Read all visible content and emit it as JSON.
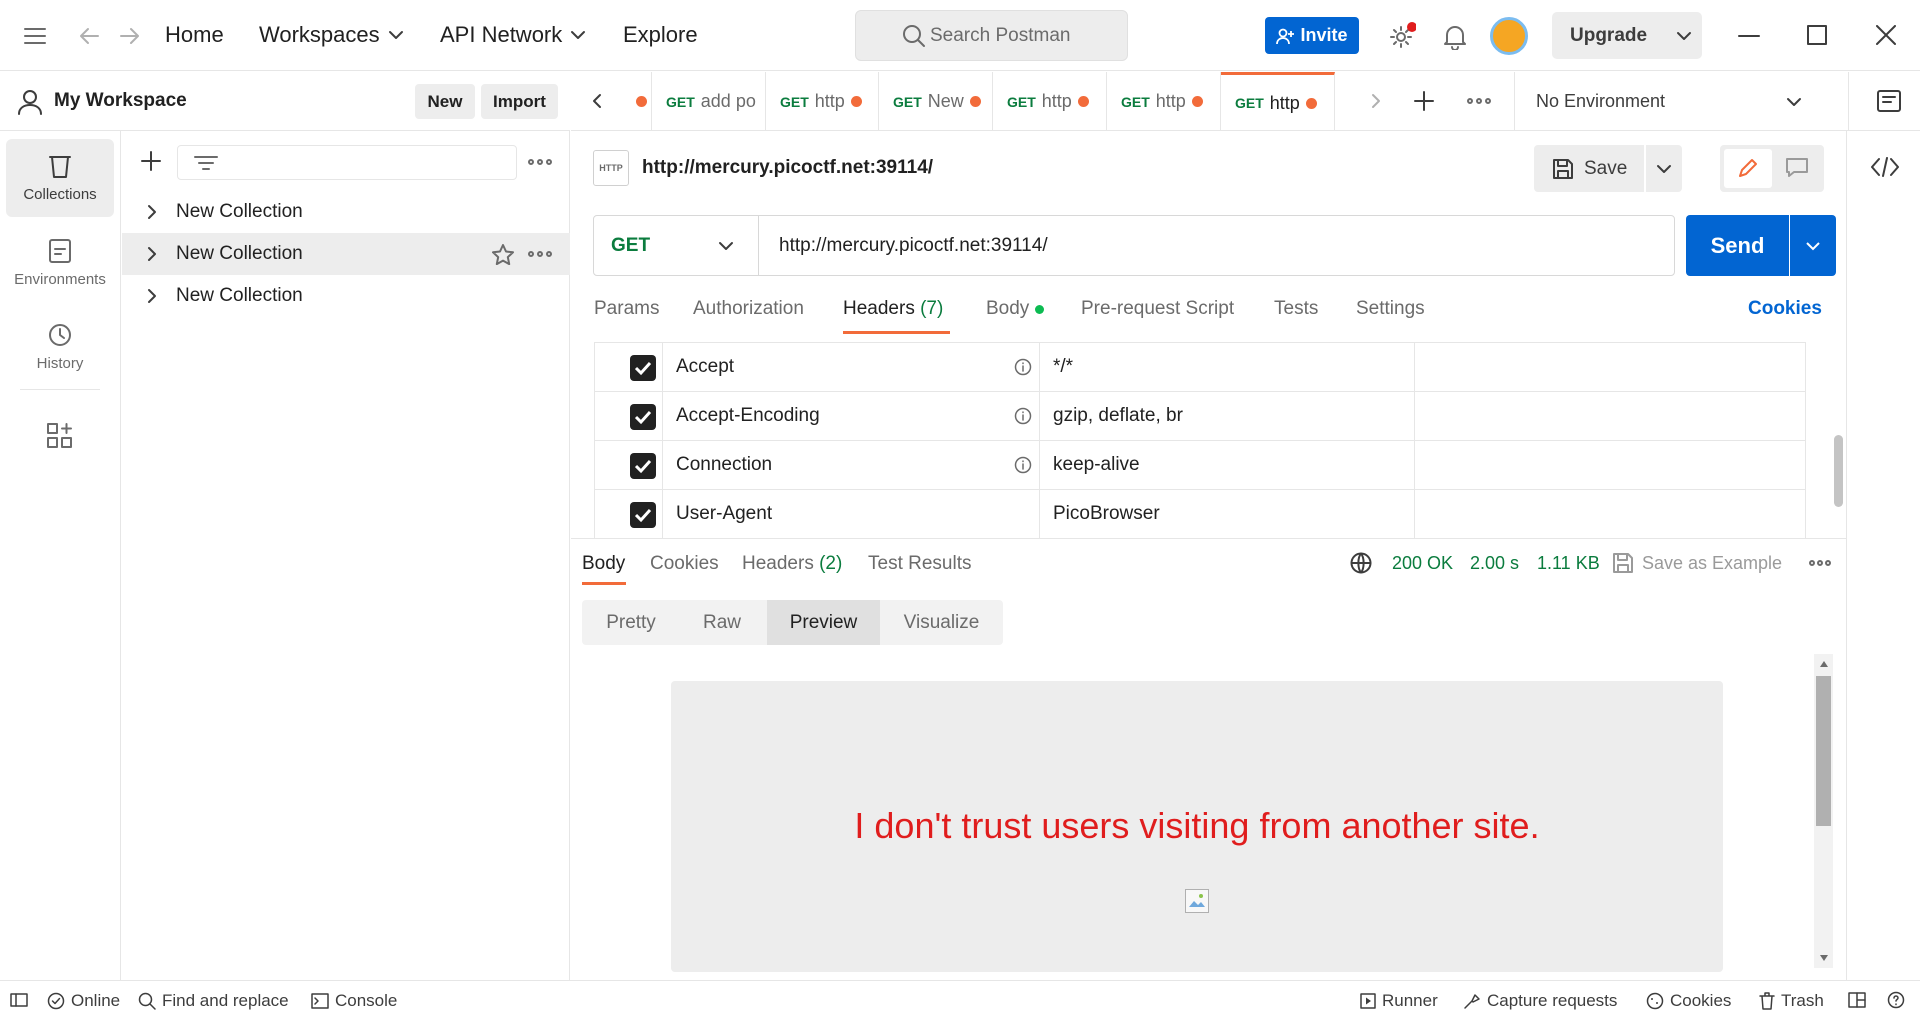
{
  "topbar": {
    "nav": [
      "Home",
      "Workspaces",
      "API Network",
      "Explore"
    ],
    "search_placeholder": "Search Postman",
    "invite_label": "Invite",
    "upgrade_label": "Upgrade"
  },
  "workspace": {
    "name": "My Workspace",
    "new_label": "New",
    "import_label": "Import"
  },
  "rail": [
    {
      "label": "Collections",
      "icon": "trash-can-icon"
    },
    {
      "label": "Environments",
      "icon": "environment-icon"
    },
    {
      "label": "History",
      "icon": "history-icon"
    }
  ],
  "collections": [
    "New Collection",
    "New Collection",
    "New Collection"
  ],
  "tabs": [
    {
      "method": "GET",
      "label": "add po"
    },
    {
      "method": "GET",
      "label": "http"
    },
    {
      "method": "GET",
      "label": "New"
    },
    {
      "method": "GET",
      "label": "http"
    },
    {
      "method": "GET",
      "label": "http"
    },
    {
      "method": "GET",
      "label": "http"
    }
  ],
  "environment": "No Environment",
  "request": {
    "title": "http://mercury.picoctf.net:39114/",
    "save_label": "Save",
    "method": "GET",
    "url": "http://mercury.picoctf.net:39114/",
    "send_label": "Send",
    "tabs": [
      "Params",
      "Authorization",
      "Headers",
      "(7)",
      "Body",
      "Pre-request Script",
      "Tests",
      "Settings"
    ],
    "cookies_label": "Cookies"
  },
  "headers": [
    {
      "key": "Accept",
      "value": "*/*",
      "info": true
    },
    {
      "key": "Accept-Encoding",
      "value": "gzip, deflate, br",
      "info": true
    },
    {
      "key": "Connection",
      "value": "keep-alive",
      "info": true
    },
    {
      "key": "User-Agent",
      "value": "PicoBrowser",
      "info": false
    }
  ],
  "response": {
    "tabs": [
      "Body",
      "Cookies",
      "Headers",
      "(2)",
      "Test Results"
    ],
    "status": "200 OK",
    "time": "2.00 s",
    "size": "1.11 KB",
    "save_example": "Save as Example",
    "views": [
      "Pretty",
      "Raw",
      "Preview",
      "Visualize"
    ],
    "preview_text": "I don't trust users visiting from another site."
  },
  "statusbar": {
    "online": "Online",
    "find_replace": "Find and replace",
    "console": "Console",
    "runner": "Runner",
    "capture": "Capture requests",
    "cookies": "Cookies",
    "trash": "Trash"
  },
  "colors": {
    "accent": "#0265d2",
    "orange": "#f26b3a",
    "green": "#0b7c3e",
    "error_text": "#e01d1d"
  }
}
